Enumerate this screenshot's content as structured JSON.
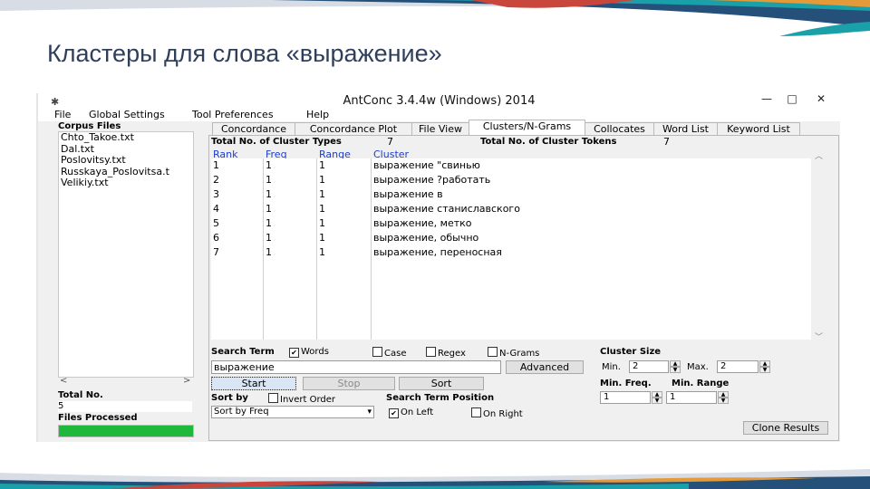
{
  "slide": {
    "title": "Кластеры для слова «выражение»"
  },
  "colors": {
    "accent_teal": "#1aa0a8",
    "accent_red": "#c9463d",
    "accent_orange": "#e59a3a",
    "accent_navy": "#24507a",
    "progress_green": "#1fb83a"
  },
  "window": {
    "title": "AntConc 3.4.4w (Windows) 2014",
    "controls": {
      "minimize": "—",
      "maximize": "□",
      "close": "✕"
    },
    "menu": [
      "File",
      "Global Settings",
      "Tool Preferences",
      "Help"
    ]
  },
  "sidebar": {
    "corpus_files_label": "Corpus Files",
    "files": [
      "Chto_Takoe.txt",
      "Dal.txt",
      "Poslovitsy.txt",
      "Russkaya_Poslovitsa.t",
      "Velikiy.txt"
    ],
    "total_no_label": "Total No.",
    "total_no_value": "5",
    "files_processed_label": "Files Processed",
    "progress": 1.0,
    "scroll_left": "<",
    "scroll_right": ">"
  },
  "tabs": [
    "Concordance",
    "Concordance Plot",
    "File View",
    "Clusters/N-Grams",
    "Collocates",
    "Word List",
    "Keyword List"
  ],
  "active_tab": "Clusters/N-Grams",
  "stats": {
    "cluster_types_label": "Total No. of Cluster Types",
    "cluster_types_value": "7",
    "cluster_tokens_label": "Total No. of Cluster Tokens",
    "cluster_tokens_value": "7"
  },
  "table": {
    "headers": [
      "Rank",
      "Freq",
      "Range",
      "Cluster"
    ],
    "rank": [
      "1",
      "2",
      "3",
      "4",
      "5",
      "6",
      "7"
    ],
    "freq": [
      "1",
      "1",
      "1",
      "1",
      "1",
      "1",
      "1"
    ],
    "range": [
      "1",
      "1",
      "1",
      "1",
      "1",
      "1",
      "1"
    ],
    "cluster": [
      "выражение \"свинью",
      "выражение ?работать",
      "выражение в",
      "выражение станиславского",
      "выражение, метко",
      "выражение, обычно",
      "выражение, переносная"
    ]
  },
  "search": {
    "term_label": "Search Term",
    "words_label": "Words",
    "case_label": "Case",
    "regex_label": "Regex",
    "ngrams_label": "N-Grams",
    "words_checked": true,
    "value": "выражение",
    "advanced_label": "Advanced"
  },
  "buttons": {
    "start": "Start",
    "stop": "Stop",
    "sort": "Sort",
    "clone": "Clone Results"
  },
  "sort": {
    "label": "Sort by",
    "invert_label": "Invert Order",
    "selected": "Sort by Freq"
  },
  "position": {
    "label": "Search Term Position",
    "on_left": "On Left",
    "on_right": "On Right",
    "on_left_checked": true
  },
  "cluster_size": {
    "label": "Cluster Size",
    "min_label": "Min.",
    "min_value": "2",
    "max_label": "Max.",
    "max_value": "2"
  },
  "min_freq": {
    "label": "Min. Freq.",
    "value": "1"
  },
  "min_range": {
    "label": "Min. Range",
    "value": "1"
  }
}
